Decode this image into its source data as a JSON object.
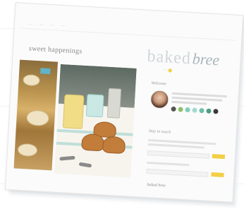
{
  "nav": {
    "items": [
      "—",
      "—",
      "—",
      "—"
    ]
  },
  "post": {
    "title": "sweet happenings"
  },
  "brand": {
    "word1": "baked",
    "word2": "bree",
    "tagline": "—"
  },
  "sidebar": {
    "welcome": "Welcome",
    "signup": "Stay in touch",
    "signature": "baked bree"
  },
  "colors": {
    "accent_yellow": "#f3cf43",
    "brand_gray": "#cfd7da",
    "social": [
      "#555555",
      "#8fbf6b",
      "#7fcfc0",
      "#a5d9cf",
      "#6bbfa4",
      "#4c9c86",
      "#3a3a3a"
    ]
  },
  "icons": [
    "avatar",
    "social-icon"
  ]
}
